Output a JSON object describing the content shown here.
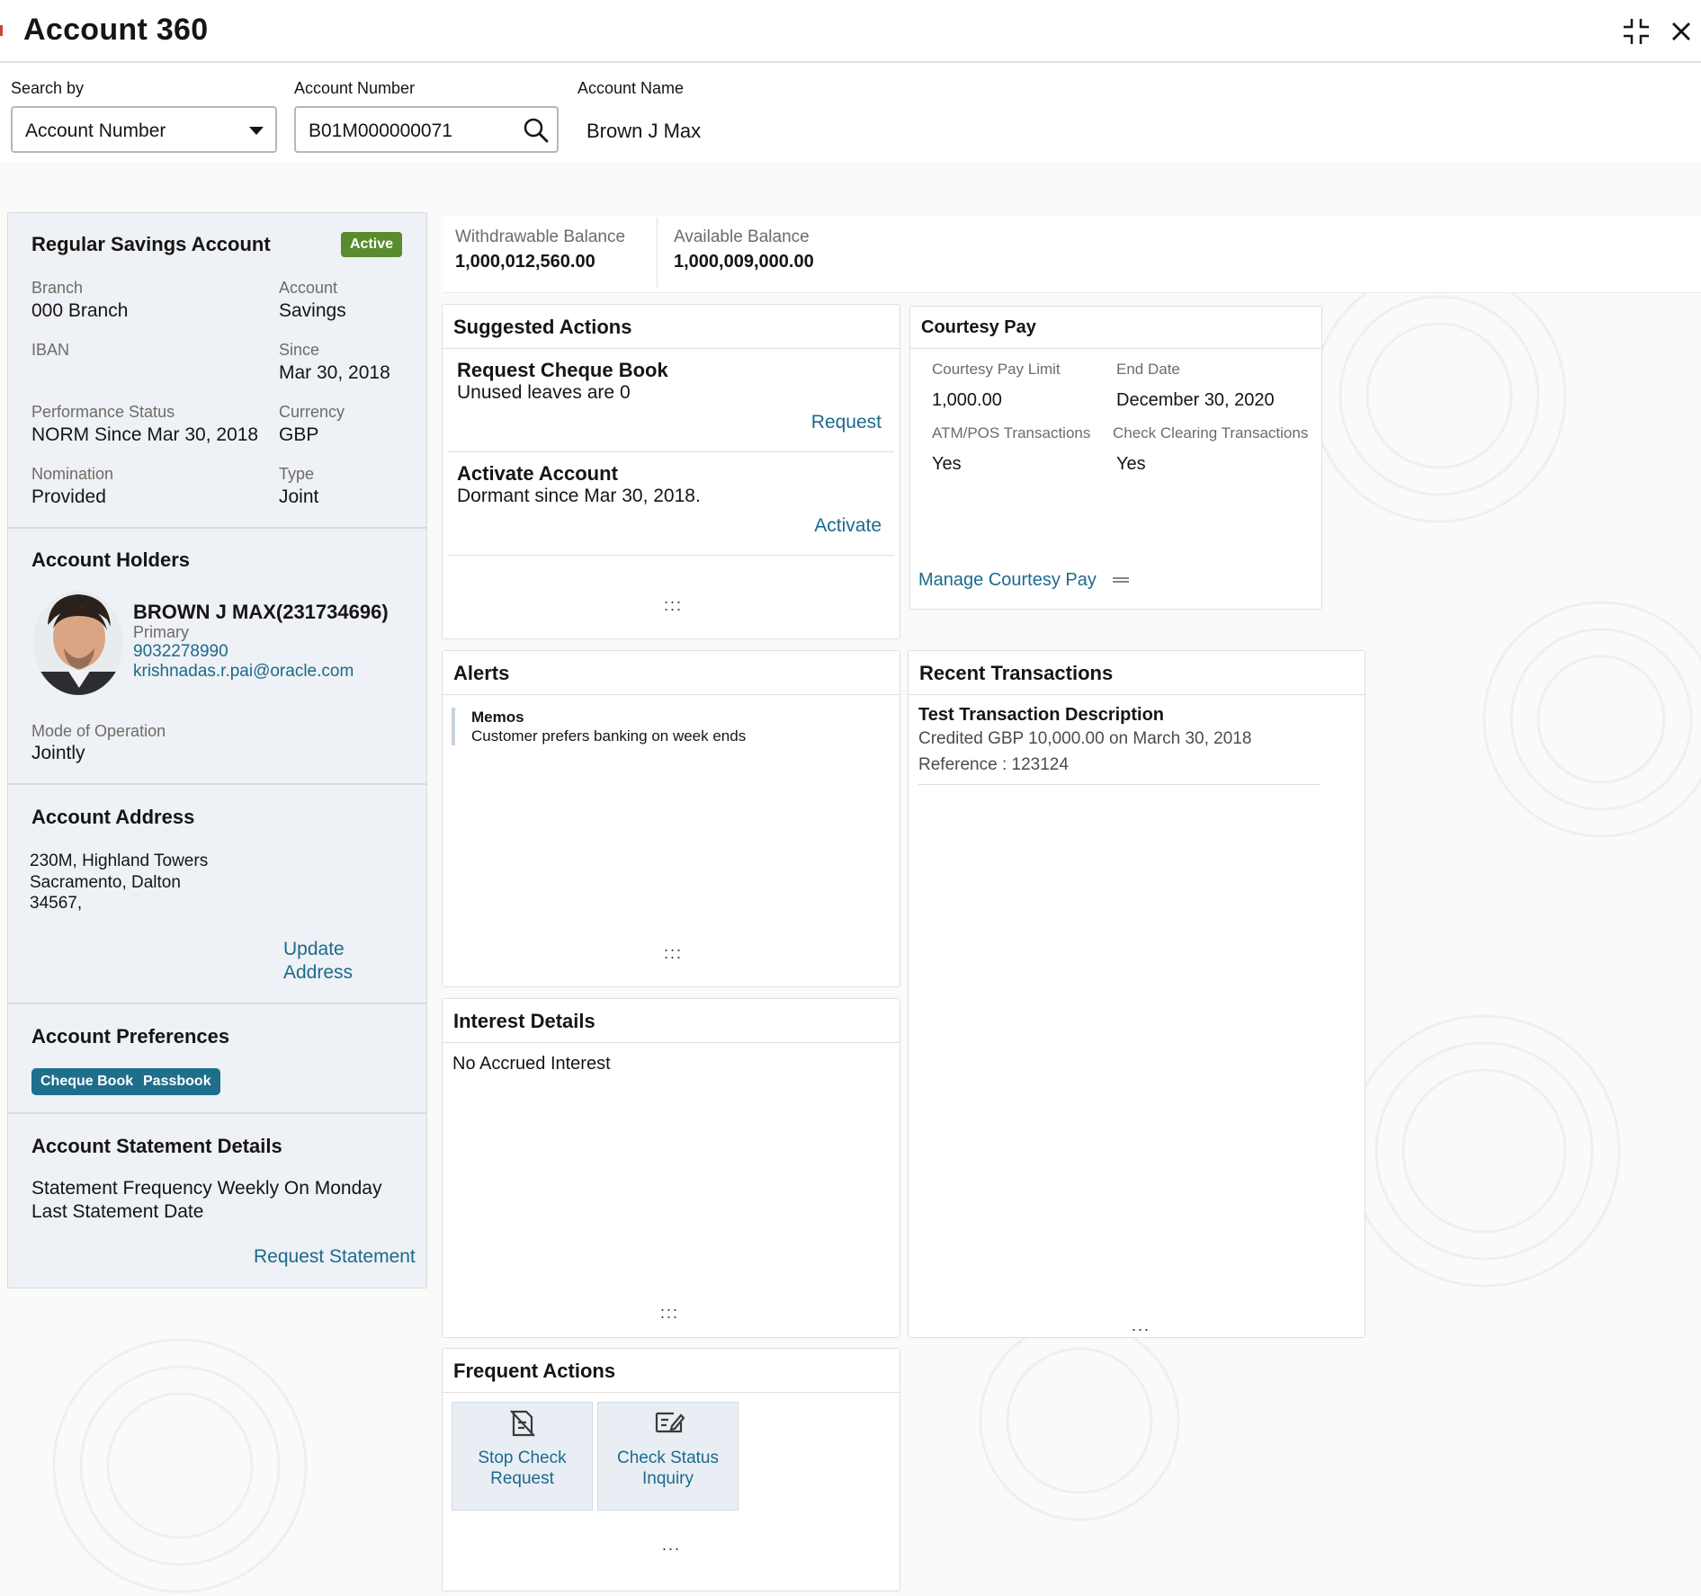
{
  "header": {
    "title": "Account 360"
  },
  "search": {
    "search_by_label": "Search by",
    "search_by_value": "Account Number",
    "account_number_label": "Account Number",
    "account_number_value": "B01M000000071",
    "account_name_label": "Account Name",
    "account_name_value": "Brown J Max"
  },
  "account": {
    "title": "Regular Savings Account",
    "status": "Active",
    "fields": [
      {
        "label": "Branch",
        "value": "000 Branch"
      },
      {
        "label": "Account",
        "value": "Savings"
      },
      {
        "label": "IBAN",
        "value": ""
      },
      {
        "label": "Since",
        "value": "Mar 30, 2018"
      },
      {
        "label": "Performance Status",
        "value": "NORM Since Mar 30, 2018"
      },
      {
        "label": "Currency",
        "value": "GBP"
      },
      {
        "label": "Nomination",
        "value": "Provided"
      },
      {
        "label": "Type",
        "value": "Joint"
      }
    ]
  },
  "holders": {
    "title": "Account Holders",
    "name": "BROWN J MAX(231734696)",
    "role": "Primary",
    "phone": "9032278990",
    "email": "krishnadas.r.pai@oracle.com",
    "mode_label": "Mode of Operation",
    "mode_value": "Jointly"
  },
  "address": {
    "title": "Account Address",
    "line1": "230M, Highland Towers",
    "line2": "Sacramento, Dalton",
    "line3": "34567,",
    "update_line1": "Update",
    "update_line2": "Address"
  },
  "preferences": {
    "title": "Account Preferences",
    "chips": [
      "Cheque Book",
      "Passbook"
    ]
  },
  "statement": {
    "title": "Account Statement Details",
    "frequency": "Statement Frequency Weekly On Monday",
    "last_date": "Last Statement Date",
    "request_label": "Request Statement"
  },
  "balances": {
    "withdrawable_label": "Withdrawable Balance",
    "withdrawable_value": "1,000,012,560.00",
    "available_label": "Available Balance",
    "available_value": "1,000,009,000.00"
  },
  "suggested": {
    "title": "Suggested Actions",
    "items": [
      {
        "title": "Request Cheque Book",
        "desc": "Unused leaves are 0",
        "action": "Request"
      },
      {
        "title": "Activate Account",
        "desc": "Dormant since Mar 30, 2018.",
        "action": "Activate"
      }
    ],
    "more": ":::"
  },
  "courtesy": {
    "title": "Courtesy Pay",
    "limit_label": "Courtesy Pay Limit",
    "limit_value": "1,000.00",
    "end_label": "End Date",
    "end_value": "December 30, 2020",
    "atm_label": "ATM/POS Transactions",
    "atm_value": "Yes",
    "check_label": "Check Clearing Transactions",
    "check_value": "Yes",
    "manage_label": "Manage Courtesy Pay"
  },
  "alerts": {
    "title": "Alerts",
    "memo_title": "Memos",
    "memo_text": "Customer prefers banking on week ends",
    "more": ":::"
  },
  "recent": {
    "title": "Recent Transactions",
    "tx_title": "Test Transaction Description",
    "tx_line1": "Credited GBP 10,000.00 on March 30, 2018",
    "tx_line2": "Reference : 123124",
    "more": "..."
  },
  "interest": {
    "title": "Interest Details",
    "text": "No Accrued Interest",
    "more": ":::"
  },
  "frequent": {
    "title": "Frequent Actions",
    "tiles": [
      {
        "line1": "Stop Check",
        "line2": "Request"
      },
      {
        "line1": "Check Status",
        "line2": "Inquiry"
      }
    ],
    "more": "..."
  },
  "icons": {
    "dropdown": "chevron-down-icon",
    "search": "search-icon",
    "collapse": "collapse-icon",
    "close": "close-icon",
    "avatar": "avatar"
  },
  "colors": {
    "link": "#1b6a8c",
    "active_badge": "#5a8b2c",
    "chip": "#1d6f8c",
    "panel_bg": "#eef1f5"
  }
}
